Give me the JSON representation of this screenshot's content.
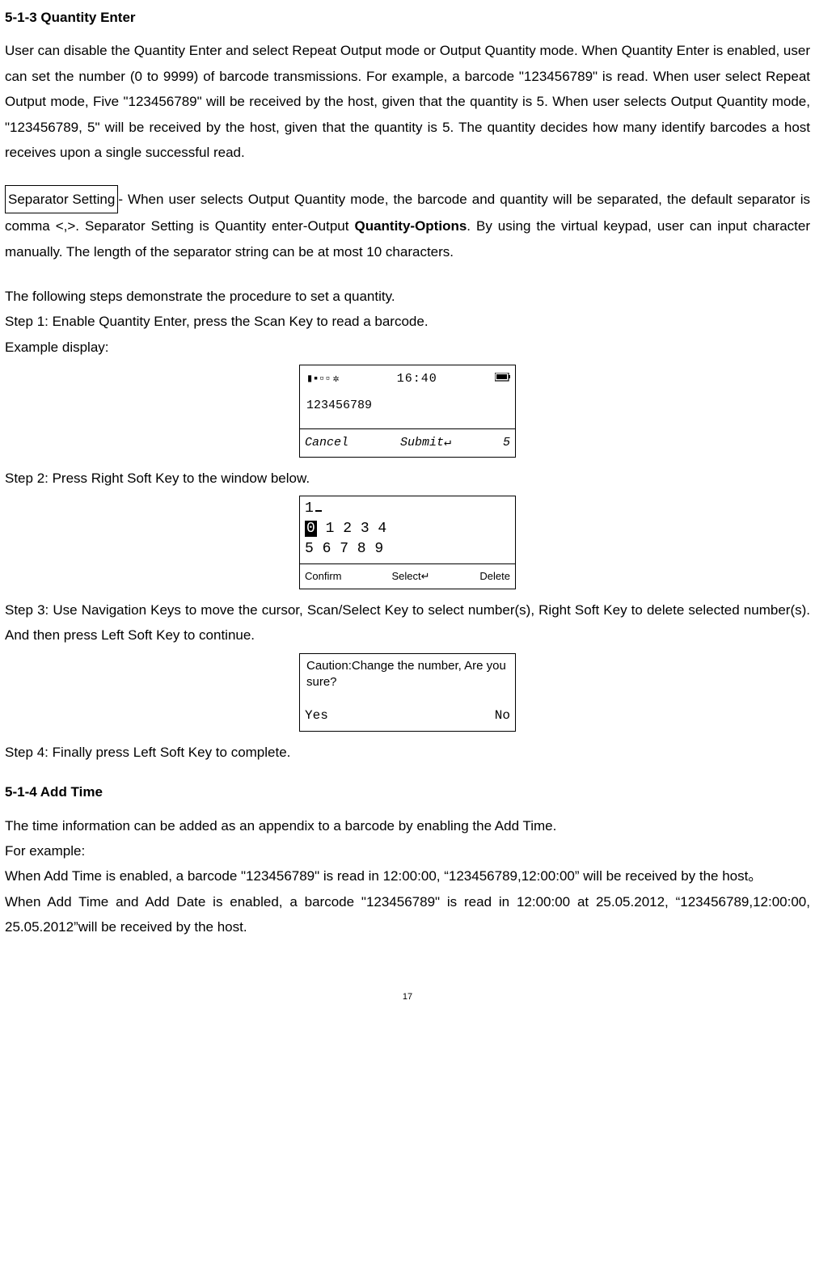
{
  "section513_title": "5-1-3 Quantity Enter",
  "section513_para": "User can disable the Quantity Enter and select Repeat Output mode or Output Quantity mode. When Quantity Enter is enabled, user can set the number (0 to 9999) of barcode transmissions. For example, a barcode \"123456789\" is read. When user select Repeat Output mode, Five \"123456789\" will be received by the host, given that the quantity is 5. When user selects Output Quantity mode, \"123456789, 5\" will be received by the host, given that the quantity is 5. The quantity decides how many identify barcodes a host receives upon a single successful read.",
  "separator_boxed": "Separator Setting",
  "separator_text1": "- When user selects Output Quantity mode, the barcode and quantity will be separated, the default separator is comma <,>. Separator Setting is Quantity enter-Output ",
  "separator_bold": "Quantity-Options",
  "separator_text2": ". By using the virtual keypad, user can input character manually. The length of the separator string can be at most 10 characters.",
  "procedure_intro": "The following steps demonstrate the procedure to set a quantity.",
  "step1": "Step 1: Enable Quantity Enter, press the Scan Key to read a barcode.",
  "example_display_label": "Example display:",
  "screen1": {
    "signal_icons": "▮▪▫▫",
    "gear_icon": "✲",
    "time": "16:40",
    "barcode_value": "123456789",
    "left_soft": "Cancel",
    "mid_soft": "Submit↵",
    "right_soft": "5"
  },
  "step2": "Step 2: Press Right Soft Key to the window below.",
  "screen2": {
    "input_prefix": "1",
    "row1_highlight": "0",
    "row1_rest": " 1 2 3 4",
    "row2": "5 6 7 8 9",
    "left_soft": "Confirm",
    "mid_soft": "Select↵",
    "right_soft": "Delete"
  },
  "step3": "Step 3: Use Navigation Keys to move the cursor, Scan/Select Key to select number(s), Right Soft Key to delete selected number(s). And then press Left Soft Key to continue.",
  "screen3": {
    "caution_line": "Caution:Change the number, Are you sure?",
    "yes": "Yes",
    "no": "No"
  },
  "step4": "Step 4: Finally press Left Soft Key to complete.",
  "section514_title": "5-1-4 Add Time",
  "addtime_para1": "The time information can be added as an appendix to a barcode by enabling the Add Time.",
  "for_example": "For example:",
  "addtime_para2": "When Add Time is enabled, a barcode \"123456789\" is read in 12:00:00, “123456789,12:00:00” will be received by the host。",
  "addtime_para3": "When Add Time and Add Date is enabled, a barcode \"123456789\" is read in 12:00:00 at 25.05.2012, “123456789,12:00:00, 25.05.2012”will be received by the host.",
  "page_number": "17"
}
